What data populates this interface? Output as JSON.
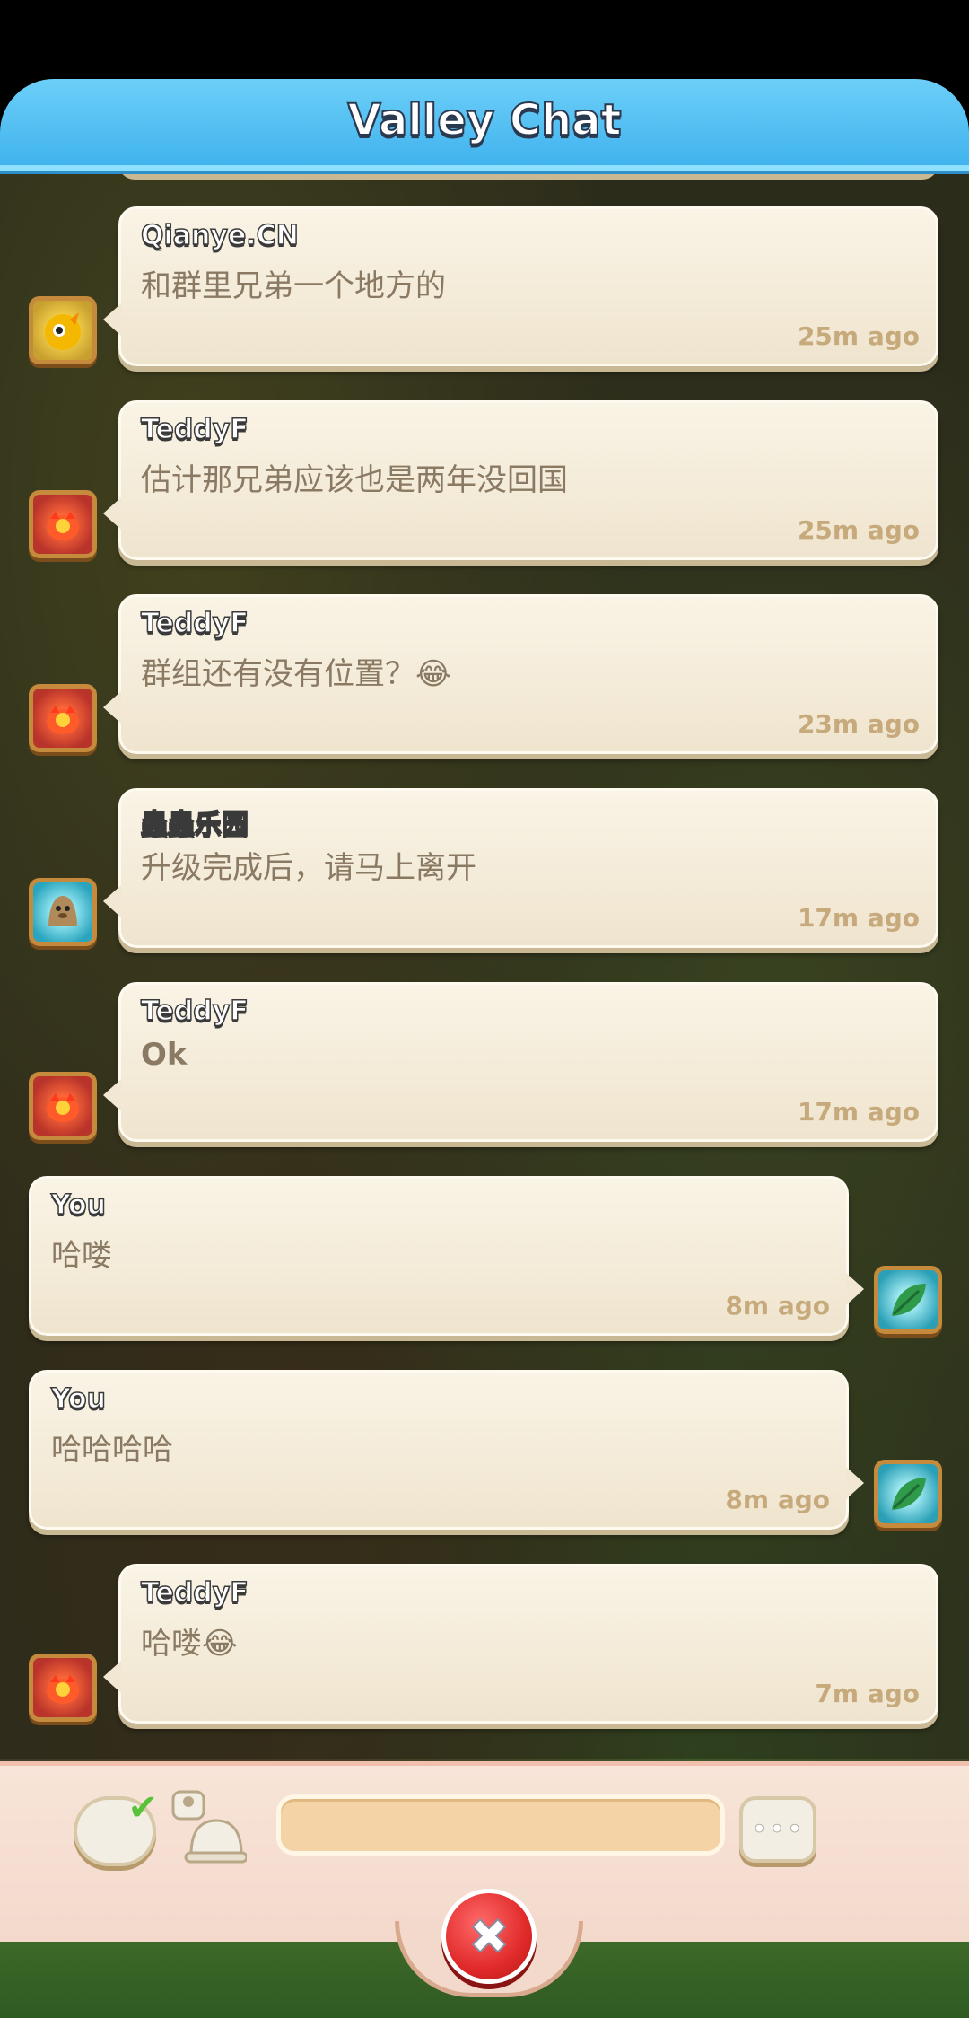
{
  "header": {
    "title": "Valley Chat"
  },
  "messages": [
    {
      "side": "left",
      "sender": "Qianye.CN",
      "text": "和群里兄弟一个地方的",
      "time": "25m ago",
      "avatar": "duck-avatar-icon"
    },
    {
      "side": "left",
      "sender": "TeddyF",
      "text": "估计那兄弟应该也是两年没回国",
      "time": "25m ago",
      "avatar": "fire-creature-avatar-icon"
    },
    {
      "side": "left",
      "sender": "TeddyF",
      "text": "群组还有没有位置？😂",
      "time": "23m ago",
      "avatar": "fire-creature-avatar-icon"
    },
    {
      "side": "left",
      "sender": "蟲蟲乐园",
      "text": "升级完成后，请马上离开",
      "time": "17m ago",
      "avatar": "mole-avatar-icon"
    },
    {
      "side": "left",
      "sender": "TeddyF",
      "text": "Ok",
      "time": "17m ago",
      "avatar": "fire-creature-avatar-icon"
    },
    {
      "side": "right",
      "sender": "You",
      "text": "哈喽",
      "time": "8m ago",
      "avatar": "leaf-avatar-icon"
    },
    {
      "side": "right",
      "sender": "You",
      "text": "哈哈哈哈",
      "time": "8m ago",
      "avatar": "leaf-avatar-icon"
    },
    {
      "side": "left",
      "sender": "TeddyF",
      "text": "哈喽😂",
      "time": "7m ago",
      "avatar": "fire-creature-avatar-icon"
    }
  ],
  "composer": {
    "input_value": "",
    "filter_icon": "chat-check-icon",
    "mention_icon": "bell-icon",
    "send_icon": "speech-bubble-icon",
    "send_glyph": "•••"
  },
  "close": {
    "icon": "close-icon",
    "glyph": "✖"
  },
  "colors": {
    "header": "#41b3ee",
    "bubble": "#f5ecdb",
    "close": "#e12a2a"
  }
}
